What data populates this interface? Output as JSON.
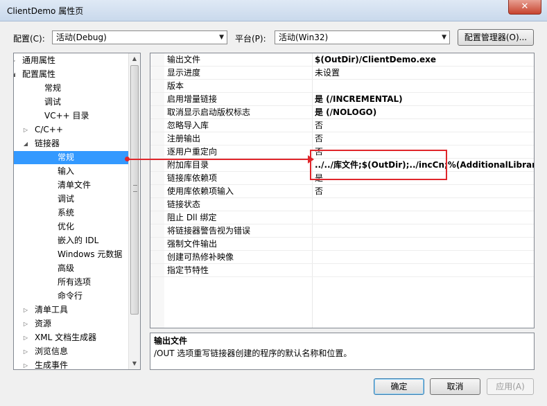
{
  "window": {
    "title": "ClientDemo 属性页",
    "close_label": "✕"
  },
  "config": {
    "label": "配置(C):",
    "value": "活动(Debug)",
    "platform_label": "平台(P):",
    "platform_value": "活动(Win32)",
    "manager_button": "配置管理器(O)..."
  },
  "tree": {
    "items": [
      {
        "label": "通用属性",
        "exp": "▷"
      },
      {
        "label": "配置属性",
        "exp": "◢"
      },
      {
        "label": "常规",
        "exp": ""
      },
      {
        "label": "调试",
        "exp": ""
      },
      {
        "label": "VC++ 目录",
        "exp": ""
      },
      {
        "label": "C/C++",
        "exp": "▷"
      },
      {
        "label": "链接器",
        "exp": "◢"
      },
      {
        "label": "常规",
        "exp": "",
        "selected": true
      },
      {
        "label": "输入",
        "exp": ""
      },
      {
        "label": "清单文件",
        "exp": ""
      },
      {
        "label": "调试",
        "exp": ""
      },
      {
        "label": "系统",
        "exp": ""
      },
      {
        "label": "优化",
        "exp": ""
      },
      {
        "label": "嵌入的 IDL",
        "exp": ""
      },
      {
        "label": "Windows 元数据",
        "exp": ""
      },
      {
        "label": "高级",
        "exp": ""
      },
      {
        "label": "所有选项",
        "exp": ""
      },
      {
        "label": "命令行",
        "exp": ""
      },
      {
        "label": "清单工具",
        "exp": "▷"
      },
      {
        "label": "资源",
        "exp": "▷"
      },
      {
        "label": "XML 文档生成器",
        "exp": "▷"
      },
      {
        "label": "浏览信息",
        "exp": "▷"
      },
      {
        "label": "生成事件",
        "exp": "▷"
      }
    ]
  },
  "properties": {
    "rows": [
      {
        "name": "输出文件",
        "value": "$(OutDir)/ClientDemo.exe",
        "bold": true
      },
      {
        "name": "显示进度",
        "value": "未设置",
        "bold": false
      },
      {
        "name": "版本",
        "value": "",
        "bold": false
      },
      {
        "name": "启用增量链接",
        "value": "是 (/INCREMENTAL)",
        "bold": true
      },
      {
        "name": "取消显示启动版权标志",
        "value": "是 (/NOLOGO)",
        "bold": true
      },
      {
        "name": "忽略导入库",
        "value": "否",
        "bold": false
      },
      {
        "name": "注册输出",
        "value": "否",
        "bold": false
      },
      {
        "name": "逐用户重定向",
        "value": "否",
        "bold": false
      },
      {
        "name": "附加库目录",
        "value": "../../库文件;$(OutDir);../incCn;%(AdditionalLibraryDirectories)",
        "bold": true
      },
      {
        "name": "链接库依赖项",
        "value": "是",
        "bold": false
      },
      {
        "name": "使用库依赖项输入",
        "value": "否",
        "bold": false
      },
      {
        "name": "链接状态",
        "value": "",
        "bold": false
      },
      {
        "name": "阻止 Dll 绑定",
        "value": "",
        "bold": false
      },
      {
        "name": "将链接器警告视为错误",
        "value": "",
        "bold": false
      },
      {
        "name": "强制文件输出",
        "value": "",
        "bold": false
      },
      {
        "name": "创建可热修补映像",
        "value": "",
        "bold": false
      },
      {
        "name": "指定节特性",
        "value": "",
        "bold": false
      }
    ]
  },
  "description": {
    "title": "输出文件",
    "text": "/OUT 选项重写链接器创建的程序的默认名称和位置。"
  },
  "buttons": {
    "ok": "确定",
    "cancel": "取消",
    "apply": "应用(A)"
  },
  "colors": {
    "selection": "#3399ff",
    "annotation": "#e0262b"
  }
}
